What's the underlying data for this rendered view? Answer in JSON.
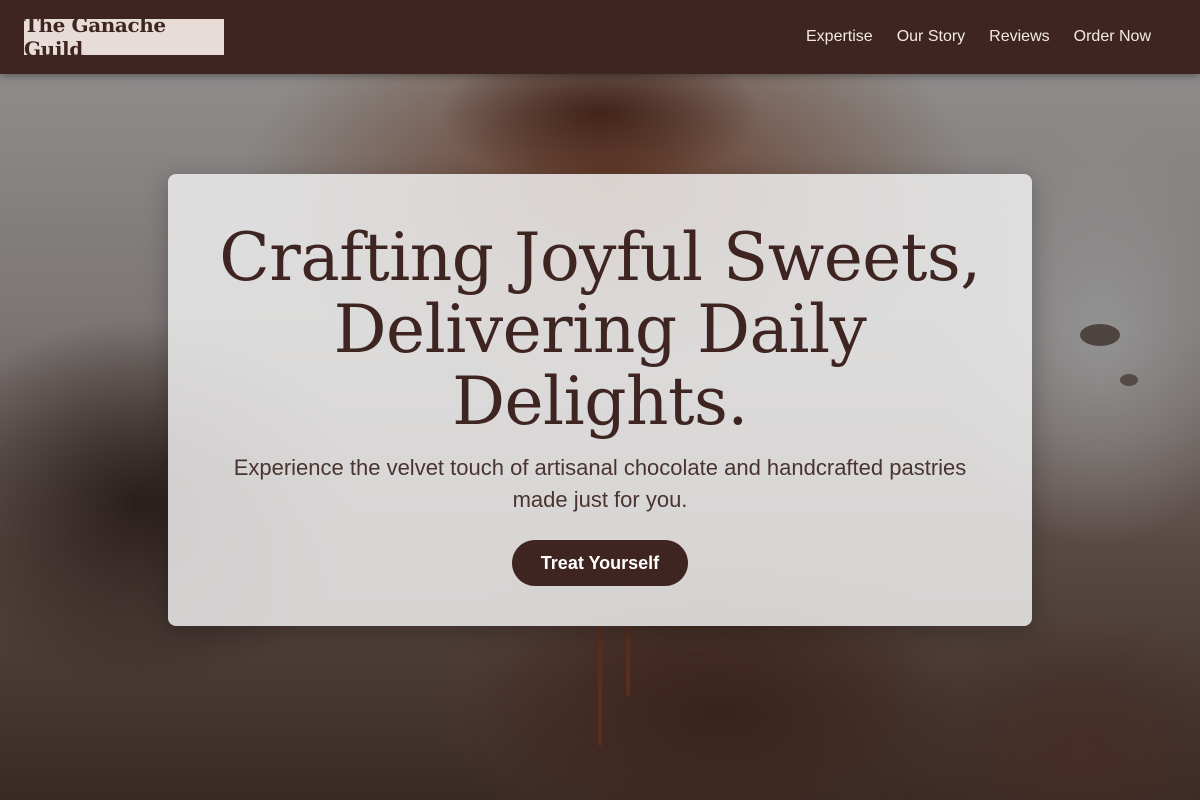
{
  "brand": {
    "name": "The Ganache Guild"
  },
  "nav": {
    "links": [
      "Expertise",
      "Our Story",
      "Reviews",
      "Order Now"
    ]
  },
  "hero": {
    "headline": "Crafting Joyful Sweets, Delivering Daily Delights.",
    "subtext": "Experience the velvet touch of artisanal chocolate and handcrafted pastries made just for you.",
    "cta_label": "Treat Yourself"
  },
  "colors": {
    "primary": "#3e2522",
    "logo_background": "#e8dcd8",
    "card_background": "#ececec",
    "nav_text": "#f3e9e5"
  }
}
